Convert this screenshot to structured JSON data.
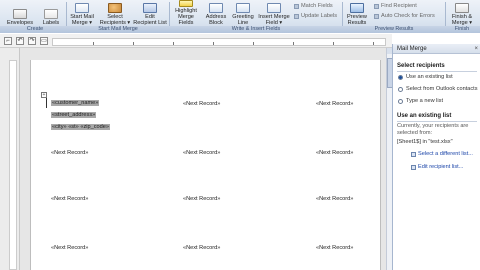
{
  "ribbon": {
    "buttons": [
      {
        "id": "envelopes",
        "label": "Envelopes",
        "icon": "envelope-icon"
      },
      {
        "id": "labels",
        "label": "Labels",
        "icon": "labels-icon"
      },
      {
        "id": "start",
        "label": "Start Mail Merge ▾",
        "icon": "start-mail-merge-icon"
      },
      {
        "id": "select",
        "label": "Select Recipients ▾",
        "icon": "select-recipients-icon"
      },
      {
        "id": "edit",
        "label": "Edit Recipient List",
        "icon": "edit-recipient-list-icon"
      },
      {
        "id": "highlight",
        "label": "Highlight Merge Fields",
        "icon": "highlight-icon"
      },
      {
        "id": "address",
        "label": "Address Block",
        "icon": "address-block-icon"
      },
      {
        "id": "greeting",
        "label": "Greeting Line",
        "icon": "greeting-line-icon"
      },
      {
        "id": "insert",
        "label": "Insert Merge Field ▾",
        "icon": "insert-merge-field-icon"
      },
      {
        "id": "preview",
        "label": "Preview Results",
        "icon": "preview-results-icon"
      },
      {
        "id": "finish",
        "label": "Finish & Merge ▾",
        "icon": "finish-merge-icon"
      }
    ],
    "small": {
      "match_fields": "Match Fields",
      "update_labels": "Update Labels",
      "find_recipient": "Find Recipient",
      "auto_check": "Auto Check for Errors"
    },
    "groups": {
      "create": "Create",
      "start": "Start Mail Merge",
      "write_insert": "Write & Insert Fields",
      "preview": "Preview Results",
      "finish": "Finish"
    }
  },
  "document": {
    "fields_first": {
      "customer_name": "«customer_name»",
      "street_address": "«street_address»",
      "city": "«city»",
      "st": "«st»",
      "zip_code": "«zip_code»"
    },
    "next_record": "«Next Record»"
  },
  "pane": {
    "title": "Mail Merge",
    "close": "×",
    "select_heading": "Select recipients",
    "options": [
      {
        "label": "Use an existing list",
        "selected": true
      },
      {
        "label": "Select from Outlook contacts",
        "selected": false
      },
      {
        "label": "Type a new list",
        "selected": false
      }
    ],
    "existing_heading": "Use an existing list",
    "existing_desc": "Currently, your recipients are selected from:",
    "source": "[Sheet1$] in \"test.xlsx\"",
    "link_select": "Select a different list...",
    "link_edit": "Edit recipient list..."
  }
}
